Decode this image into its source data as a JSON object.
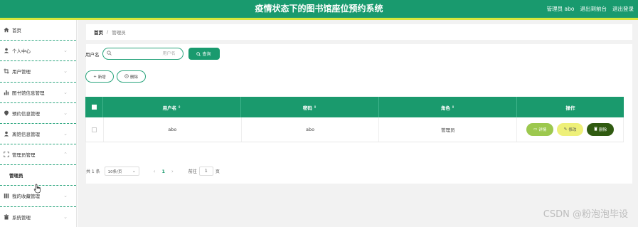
{
  "header": {
    "title": "疫情状态下的图书馆座位预约系统",
    "user_label": "管理员 abo",
    "back_link": "退出到前台",
    "logout_link": "退出登录"
  },
  "sidebar": {
    "items": [
      {
        "label": "首页",
        "icon": "home-icon"
      },
      {
        "label": "个人中心",
        "icon": "person-icon"
      },
      {
        "label": "用户管理",
        "icon": "crop-icon"
      },
      {
        "label": "图书馆信息管理",
        "icon": "bar-chart-icon"
      },
      {
        "label": "预约信息管理",
        "icon": "location-icon"
      },
      {
        "label": "离馆信息管理",
        "icon": "person-icon"
      },
      {
        "label": "管理员管理",
        "icon": "fullscreen-icon"
      }
    ],
    "submenu_item": "管理员",
    "items_after": [
      {
        "label": "我的收藏管理",
        "icon": "library-icon"
      },
      {
        "label": "系统管理",
        "icon": "trash-icon"
      }
    ]
  },
  "breadcrumb": {
    "home": "首页",
    "separator": "/",
    "current": "管理员"
  },
  "search": {
    "label": "用户名",
    "placeholder": "用户名",
    "button": "查询"
  },
  "actions": {
    "add": "新增",
    "delete": "删除"
  },
  "table": {
    "columns": [
      "用户名",
      "密码",
      "角色",
      "操作"
    ],
    "rows": [
      {
        "username": "abo",
        "password": "abo",
        "role": "管理员"
      }
    ],
    "row_actions": {
      "detail": "详情",
      "edit": "修改",
      "delete": "删除"
    }
  },
  "pagination": {
    "total": "共 1 条",
    "page_size": "10条/页",
    "current_page": "1",
    "goto_label": "前往",
    "goto_value": "1",
    "page_unit": "页"
  },
  "watermark": "CSDN @粉泡泡毕设",
  "colors": {
    "primary": "#199a6e",
    "accent_stripe": "#d8e63c",
    "detail_btn": "#9cc84e",
    "edit_btn": "#eef079",
    "delete_btn": "#2f5a10"
  }
}
